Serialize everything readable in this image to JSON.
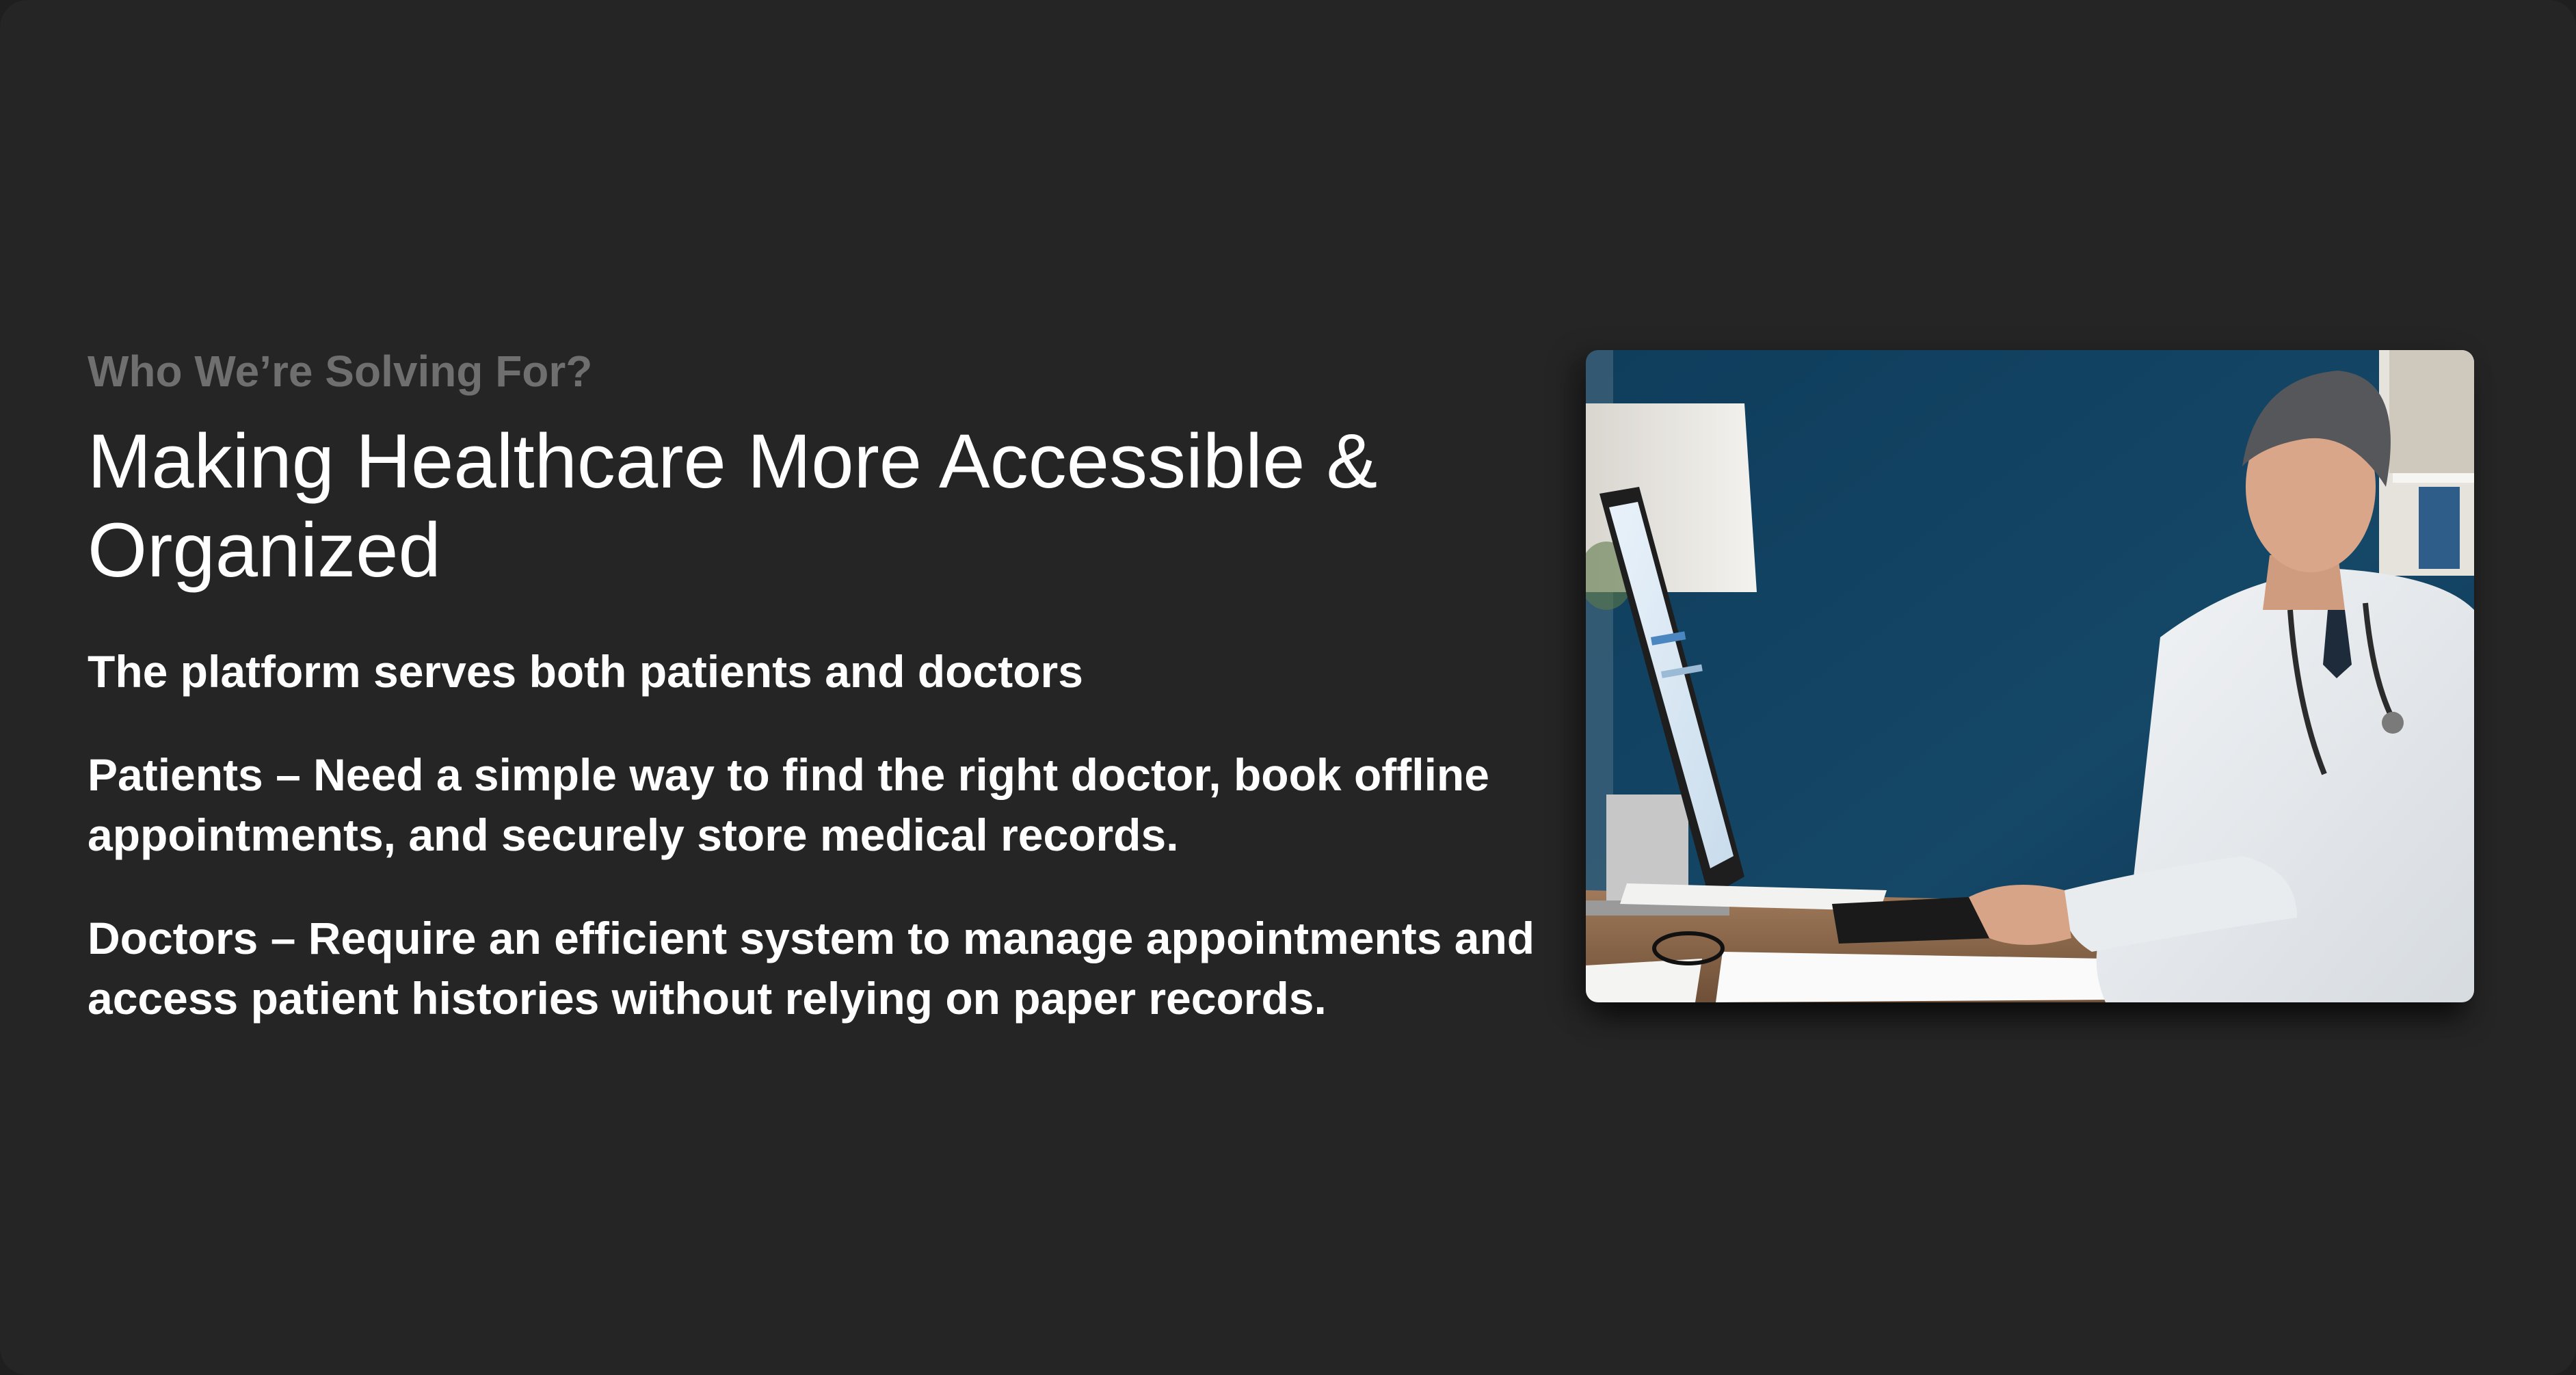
{
  "section": {
    "eyebrow": "Who We’re Solving For?",
    "title": "Making Healthcare More Accessible & Organized",
    "intro": "The platform serves both patients and doctors",
    "patients": "Patients – Need a simple way to find the right doctor, book offline appointments, and securely store medical records.",
    "doctors": "Doctors – Require an efficient system to manage appointments and access patient histories without relying on paper records."
  },
  "colors": {
    "background": "#252525",
    "eyebrow": "#6f6f6f",
    "text": "#ffffff",
    "photo_wall": "#13405e"
  }
}
